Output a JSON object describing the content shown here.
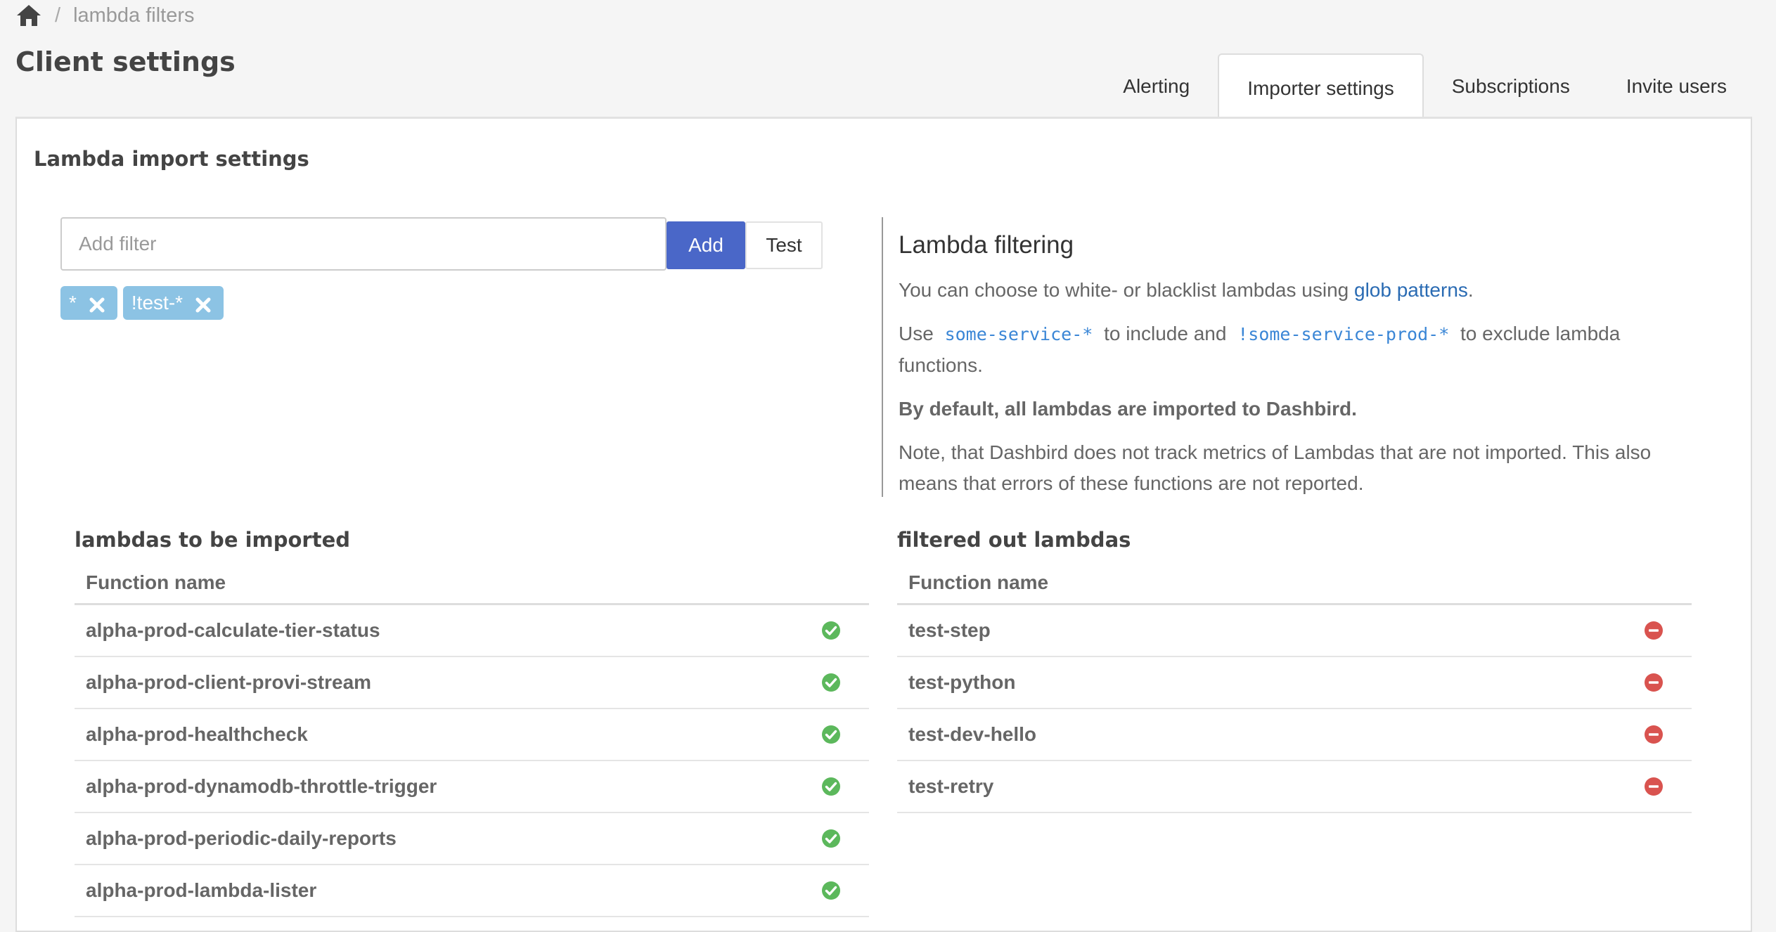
{
  "breadcrumb": {
    "home_icon": "home-icon",
    "separator": "/",
    "current": "lambda filters"
  },
  "page_title": "Client settings",
  "tabs": [
    {
      "label": "Alerting",
      "active": false
    },
    {
      "label": "Importer settings",
      "active": true
    },
    {
      "label": "Subscriptions",
      "active": false
    },
    {
      "label": "Invite users",
      "active": false
    }
  ],
  "section_title": "Lambda import settings",
  "filter": {
    "placeholder": "Add filter",
    "value": "",
    "add_label": "Add",
    "test_label": "Test",
    "tags": [
      {
        "label": "*"
      },
      {
        "label": "!test-*"
      }
    ]
  },
  "info": {
    "heading": "Lambda filtering",
    "p1_text": "You can choose to white- or blacklist lambdas using",
    "p1_link": "glob patterns",
    "p1_end": ".",
    "p2_use": "Use",
    "p2_code1": "some-service-*",
    "p2_mid": "to include and",
    "p2_code2": "!some-service-prod-*",
    "p2_end": "to exclude lambda functions.",
    "p3_bold": "By default, all lambdas are imported to Dashbird.",
    "p4": "Note, that Dashbird does not track metrics of Lambdas that are not imported. This also means that errors of these functions are not reported."
  },
  "imported": {
    "title": "lambdas to be imported",
    "column": "Function name",
    "rows": [
      "alpha-prod-calculate-tier-status",
      "alpha-prod-client-provi-stream",
      "alpha-prod-healthcheck",
      "alpha-prod-dynamodb-throttle-trigger",
      "alpha-prod-periodic-daily-reports",
      "alpha-prod-lambda-lister"
    ]
  },
  "filtered": {
    "title": "filtered out lambdas",
    "column": "Function name",
    "rows": [
      "test-step",
      "test-python",
      "test-dev-hello",
      "test-retry"
    ]
  },
  "colors": {
    "primary": "#4a67c8",
    "tag": "#8cc3e4",
    "ok": "#5cb85c",
    "excluded": "#d9534f",
    "link": "#2a6bb3"
  },
  "icons": {
    "ok": "check-circle-icon",
    "excluded": "minus-circle-icon"
  }
}
